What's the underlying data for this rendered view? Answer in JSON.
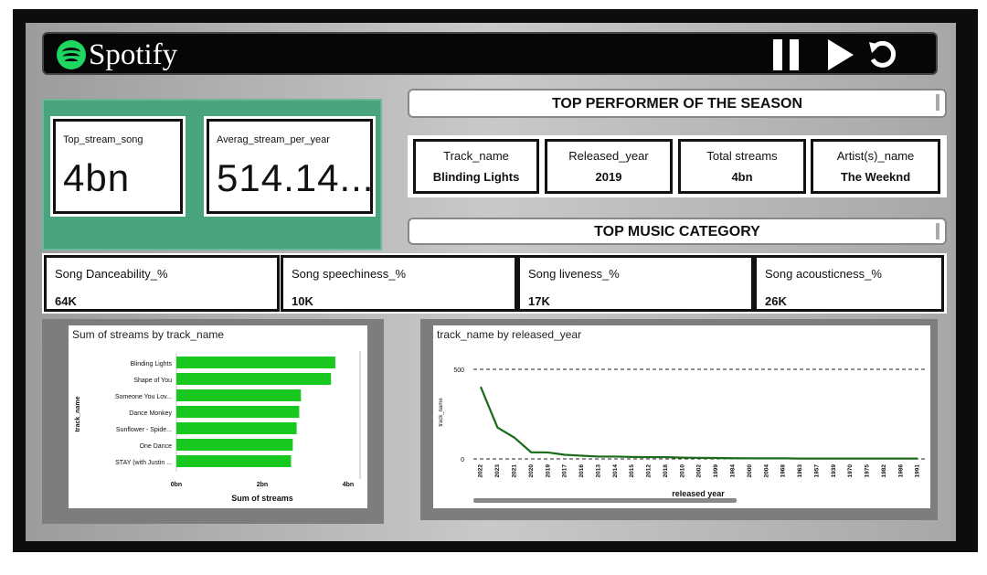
{
  "app": {
    "name": "Spotify"
  },
  "controls": {
    "pause": "pause-icon",
    "play": "play-icon",
    "replay": "replay-icon"
  },
  "kpis": [
    {
      "label": "Top_stream_song",
      "value": "4bn"
    },
    {
      "label": "Averag_stream_per_year",
      "value": "514.14..."
    }
  ],
  "top_performer": {
    "title": "TOP PERFORMER OF THE SEASON",
    "cells": [
      {
        "header": "Track_name",
        "value": "Blinding Lights"
      },
      {
        "header": "Released_year",
        "value": "2019"
      },
      {
        "header": "Total streams",
        "value": "4bn"
      },
      {
        "header": "Artist(s)_name",
        "value": "The Weeknd"
      }
    ]
  },
  "top_music": {
    "title": "TOP MUSIC CATEGORY",
    "metrics": [
      {
        "header": "Song Danceability_%",
        "value": "64K"
      },
      {
        "header": "Song speechiness_%",
        "value": "10K"
      },
      {
        "header": "Song liveness_%",
        "value": "17K"
      },
      {
        "header": "Song acousticness_%",
        "value": "26K"
      }
    ]
  },
  "colors": {
    "accent": "#1ed760",
    "bar": "#18c81e",
    "line": "#1a6b1a",
    "panel": "#48a47c"
  },
  "chart_data": [
    {
      "type": "bar",
      "title": "Sum of streams by track_name",
      "xlabel": "Sum of streams",
      "ylabel": "track_name",
      "orientation": "horizontal",
      "categories": [
        "Blinding Lights",
        "Shape of You",
        "Someone You Lov...",
        "Dance Monkey",
        "Sunflower - Spide...",
        "One Dance",
        "STAY (with Justin ..."
      ],
      "values": [
        3.7,
        3.6,
        2.9,
        2.86,
        2.8,
        2.71,
        2.67
      ],
      "xticks": [
        "0bn",
        "2bn",
        "4bn"
      ],
      "xlim": [
        0,
        4
      ],
      "unit": "bn"
    },
    {
      "type": "line",
      "title": "track_name by released_year",
      "xlabel": "released year",
      "ylabel": "track_name",
      "categories": [
        "2022",
        "2023",
        "2021",
        "2020",
        "2019",
        "2017",
        "2016",
        "2013",
        "2014",
        "2015",
        "2012",
        "2018",
        "2010",
        "2002",
        "1999",
        "1984",
        "2000",
        "2004",
        "1968",
        "1963",
        "1957",
        "1939",
        "1970",
        "1975",
        "1982",
        "1986",
        "1991"
      ],
      "values": [
        402,
        175,
        119,
        37,
        36,
        23,
        18,
        13,
        13,
        11,
        10,
        10,
        7,
        6,
        5,
        4,
        3,
        3,
        3,
        2,
        2,
        2,
        2,
        2,
        2,
        2,
        2
      ],
      "yticks": [
        "0",
        "500"
      ],
      "ylim": [
        0,
        500
      ],
      "grid": true
    }
  ]
}
